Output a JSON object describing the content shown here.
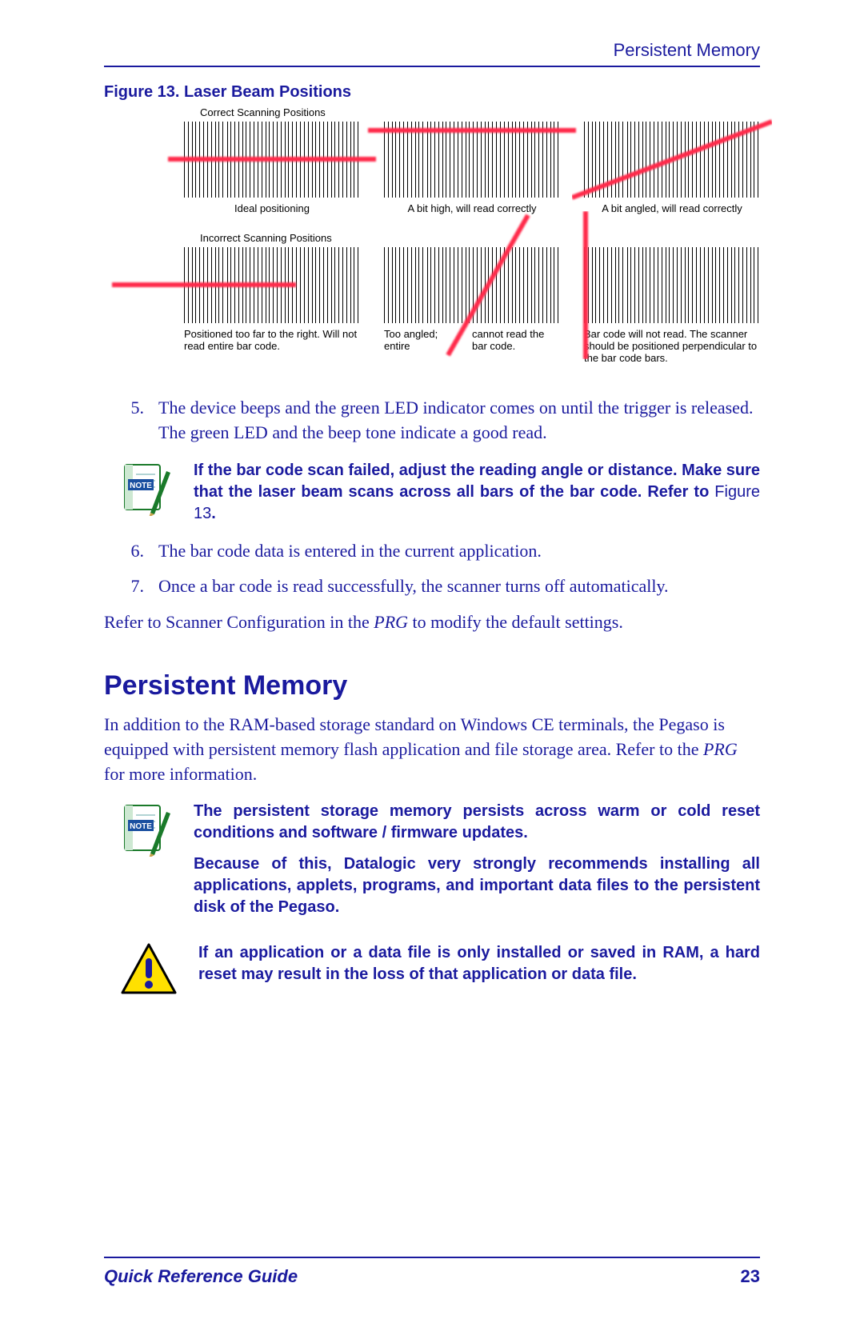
{
  "header": {
    "section": "Persistent Memory"
  },
  "figure": {
    "caption": "Figure 13. Laser Beam Positions",
    "group_correct": "Correct Scanning Positions",
    "group_incorrect": "Incorrect Scanning Positions",
    "correct": [
      {
        "label": "Ideal positioning"
      },
      {
        "label": "A bit high, will read correctly"
      },
      {
        "label": "A bit angled, will read correctly"
      }
    ],
    "incorrect": [
      {
        "label": "Positioned too far to the right. Will not read entire bar code."
      },
      {
        "label_left": "Too angled; entire",
        "label_right": "cannot read the bar code."
      },
      {
        "label": "Bar code will not read. The scanner should be positioned perpendicular to the bar code bars."
      }
    ]
  },
  "list": {
    "item5_num": "5.",
    "item5": "The device beeps and the green LED indicator comes on until the trigger is released. The green LED and the beep tone indicate a good read.",
    "item6_num": "6.",
    "item6": "The bar code data is entered in the current application.",
    "item7_num": "7.",
    "item7": "Once a bar code is read successfully, the scanner turns off automatically."
  },
  "note1": {
    "text_a": "If the bar code scan failed, adjust the reading angle or distance. Make sure that the laser beam scans across all bars of the bar code. Refer to ",
    "link": "Figure 13",
    "text_b": "."
  },
  "refer_line_a": "Refer to Scanner Configuration in the ",
  "refer_line_i": "PRG",
  "refer_line_b": " to modify the default settings.",
  "section2": {
    "title": "Persistent Memory",
    "para_a": "In addition to the RAM-based storage standard on Windows CE terminals, the Pegaso is equipped with persistent memory flash application and file storage area. Refer to the ",
    "para_i": "PRG",
    "para_b": " for more information."
  },
  "note2": {
    "p1": "The persistent storage memory persists across warm or cold reset conditions and software / firmware updates.",
    "p2": "Because of this, Datalogic very strongly recommends installing all applications, applets, programs, and important data files to the persistent disk of the Pegaso."
  },
  "warning": {
    "text": "If an application or a data file is only installed or saved in RAM, a hard reset may result in the loss of that application or data file."
  },
  "footer": {
    "title": "Quick Reference Guide",
    "page": "23"
  }
}
